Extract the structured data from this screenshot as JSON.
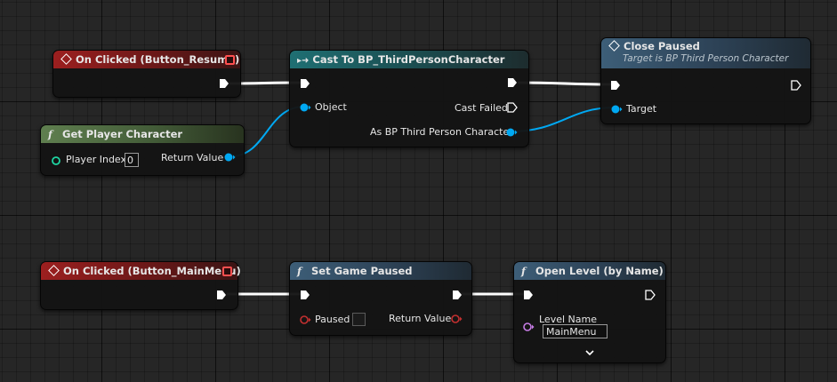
{
  "nodes": {
    "on_clicked_resume": {
      "title": "On Clicked (Button_Resume)"
    },
    "get_player_character": {
      "title": "Get Player Character",
      "player_index_label": "Player Index",
      "player_index_value": "0",
      "return_value_label": "Return Value"
    },
    "cast_to": {
      "title": "Cast To BP_ThirdPersonCharacter",
      "object_label": "Object",
      "cast_failed_label": "Cast Failed",
      "as_label": "As BP Third Person Character"
    },
    "close_paused": {
      "title": "Close Paused",
      "subtitle": "Target is BP Third Person Character",
      "target_label": "Target"
    },
    "on_clicked_mainmenu": {
      "title": "On Clicked (Button_MainMenu)"
    },
    "set_game_paused": {
      "title": "Set Game Paused",
      "paused_label": "Paused",
      "return_value_label": "Return Value"
    },
    "open_level": {
      "title": "Open Level (by Name)",
      "level_name_label": "Level Name",
      "level_name_value": "MainMenu"
    }
  },
  "colors": {
    "exec_wire": "#ffffff",
    "object_pin": "#00a8f2",
    "bool_pin": "#950101",
    "name_pin": "#c77de6",
    "int_pin": "#1ed6a3"
  },
  "icons": {
    "event": "event-diamond-icon",
    "function": "function-f-icon",
    "cast": "cast-arrow-icon",
    "expand": "chevron-down-icon"
  }
}
